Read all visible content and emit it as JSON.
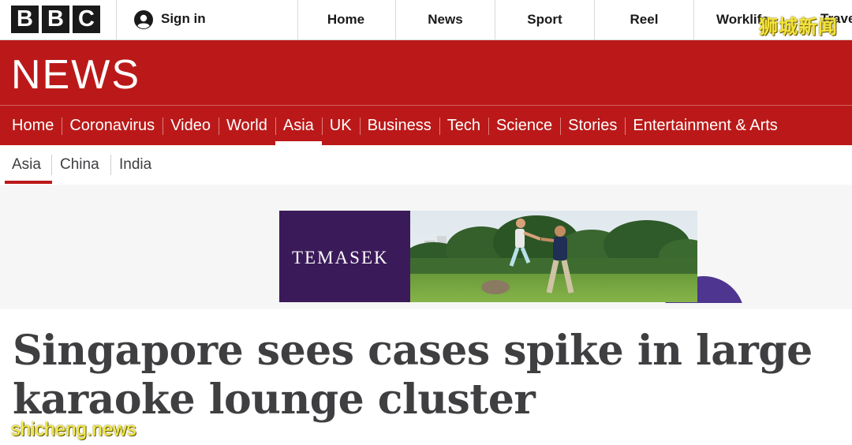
{
  "brand": {
    "letters": [
      "B",
      "B",
      "C"
    ]
  },
  "header": {
    "sign_in": "Sign in",
    "nav": [
      "Home",
      "News",
      "Sport",
      "Reel",
      "Worklife"
    ],
    "nav_last_partial": "Trave"
  },
  "watermarks": {
    "top": "狮城新闻",
    "bottom": "shicheng.news"
  },
  "masthead": {
    "title": "NEWS"
  },
  "main_nav": {
    "items": [
      "Home",
      "Coronavirus",
      "Video",
      "World",
      "Asia",
      "UK",
      "Business",
      "Tech",
      "Science",
      "Stories",
      "Entertainment & Arts"
    ],
    "active": "Asia"
  },
  "sub_nav": {
    "items": [
      "Asia",
      "China",
      "India"
    ],
    "active": "Asia"
  },
  "ad": {
    "brand": "TEMASEK"
  },
  "article": {
    "headline_line1": "Singapore sees cases spike in large",
    "headline_line2": "karaoke lounge cluster"
  },
  "colors": {
    "bbc_red": "#bb1919",
    "ad_purple": "#3b1a5a",
    "text_dark": "#3f3f42"
  }
}
